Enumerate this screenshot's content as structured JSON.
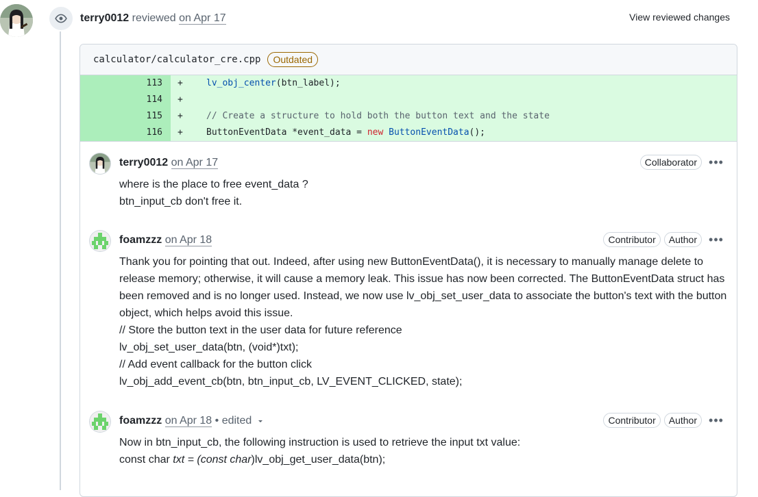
{
  "review": {
    "reviewer": "terry0012",
    "action": "reviewed",
    "date": "on Apr 17",
    "view_changes_label": "View reviewed changes"
  },
  "file": {
    "path": "calculator/calculator_cre.cpp",
    "status_badge": "Outdated"
  },
  "diff": {
    "lines": [
      {
        "number": "113",
        "sign": "+"
      },
      {
        "number": "114",
        "sign": "+"
      },
      {
        "number": "115",
        "sign": "+"
      },
      {
        "number": "116",
        "sign": "+"
      }
    ],
    "tokens": {
      "l113_fn": "lv_obj_center",
      "l113_rest": "(btn_label);",
      "l115_comment": "// Create a structure to hold both the button text and the state",
      "l116_a": "ButtonEventData *event_data = ",
      "l116_kw": "new",
      "l116_type": "ButtonEventData",
      "l116_rest": "();"
    }
  },
  "comments": [
    {
      "author": "terry0012",
      "date": "on Apr 17",
      "badges": [
        "Collaborator"
      ],
      "menu_label": "•••",
      "body": [
        "where is the place to free event_data ?",
        "btn_input_cb don't free it."
      ]
    },
    {
      "author": "foamzzz",
      "date": "on Apr 18",
      "badges": [
        "Contributor",
        "Author"
      ],
      "menu_label": "•••",
      "body": [
        "Thank you for pointing that out. Indeed, after using new ButtonEventData(), it is necessary to manually manage delete to release memory; otherwise, it will cause a memory leak. This issue has now been corrected. The ButtonEventData struct has been removed and is no longer used. Instead, we now use lv_obj_set_user_data to associate the button's text with the button object, which helps avoid this issue.",
        "// Store the button text in the user data for future reference",
        "lv_obj_set_user_data(btn, (void*)txt);",
        "// Add event callback for the button click",
        "lv_obj_add_event_cb(btn, btn_input_cb, LV_EVENT_CLICKED, state);"
      ]
    },
    {
      "author": "foamzzz",
      "date": "on Apr 18",
      "edited_label": "• edited",
      "badges": [
        "Contributor",
        "Author"
      ],
      "menu_label": "•••",
      "body": [
        "Now in btn_input_cb, the following instruction is used to retrieve the input txt value:"
      ],
      "body_code": {
        "a": "const char ",
        "b": "txt = (const char",
        "c": ")lv_obj_get_user_data(btn);"
      }
    }
  ]
}
